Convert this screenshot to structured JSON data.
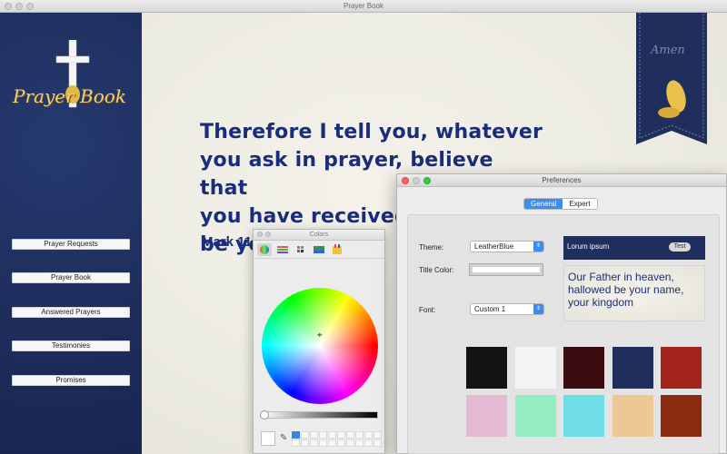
{
  "window": {
    "title": "Prayer Book"
  },
  "logo": {
    "text": "Prayer Book"
  },
  "sidebar": {
    "items": [
      {
        "label": "Prayer Requests"
      },
      {
        "label": "Prayer Book"
      },
      {
        "label": "Answered Prayers"
      },
      {
        "label": "Testimonies"
      },
      {
        "label": "Promises"
      }
    ]
  },
  "verse": {
    "lines": [
      "Therefore I tell you, whatever",
      "you ask in prayer, believe that",
      "you have received",
      "be yours."
    ],
    "reference": "Mark 11:"
  },
  "ribbon": {
    "label": "Amen"
  },
  "colors_panel": {
    "title": "Colors"
  },
  "preferences": {
    "title": "Preferences",
    "tabs": [
      "General",
      "Expert"
    ],
    "active_tab": "General",
    "theme_label": "Theme:",
    "theme_value": "LeatherBlue",
    "title_color_label": "Title Color:",
    "font_label": "Font:",
    "font_value": "Custom 1",
    "preview": {
      "title": "Lorum ipsum",
      "test_label": "Test",
      "body": "Our Father in heaven, hallowed be your name, your kingdom"
    },
    "textures": [
      {
        "name": "black",
        "color": "#121212"
      },
      {
        "name": "white",
        "color": "#f4f4f4"
      },
      {
        "name": "maroon",
        "color": "#3a0e10"
      },
      {
        "name": "navy",
        "color": "#1f2e5c"
      },
      {
        "name": "red",
        "color": "#a3241c"
      },
      {
        "name": "pink",
        "color": "#e6b9d3"
      },
      {
        "name": "mint",
        "color": "#94eec1"
      },
      {
        "name": "cyan",
        "color": "#6fdde6"
      },
      {
        "name": "light-wood",
        "color": "#ecc894"
      },
      {
        "name": "dark-wood",
        "color": "#8a2b12"
      }
    ]
  }
}
